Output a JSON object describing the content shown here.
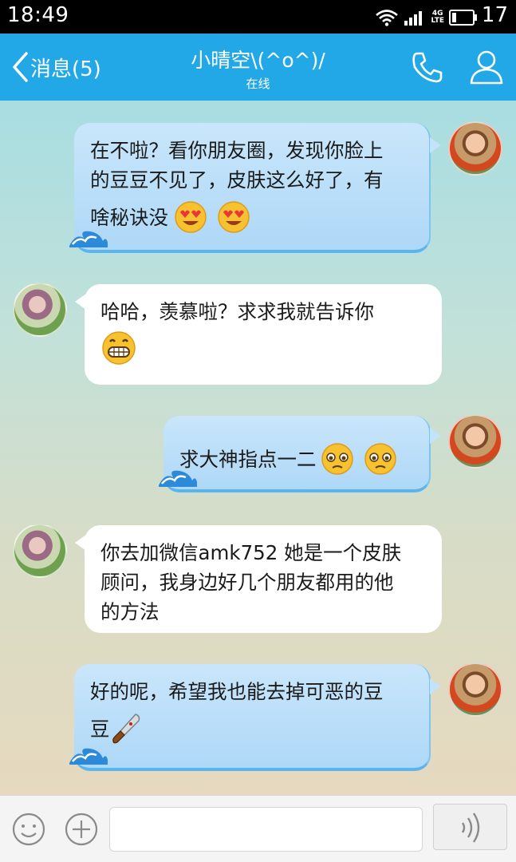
{
  "status_bar": {
    "time": "18:49",
    "network": "4G",
    "network_sub": "LTE",
    "battery_level": "17",
    "icons": [
      "wifi-icon",
      "signal-icon",
      "battery-icon"
    ]
  },
  "header": {
    "back_label": "消息(5)",
    "contact_name": "小晴空\\(^o^)/",
    "contact_status": "在线",
    "icons": [
      "chevron-left-icon",
      "phone-icon",
      "person-icon"
    ],
    "bg_color": "#22a8e6"
  },
  "messages": [
    {
      "sender": "me",
      "lines": [
        "在不啦？看你朋友圈，发现你脸上",
        "的豆豆不见了，皮肤这么好了，有",
        "啥秘诀没"
      ],
      "emojis": [
        "heart-eyes-emoji",
        "heart-eyes-emoji"
      ]
    },
    {
      "sender": "friend",
      "lines": [
        "哈哈，羡慕啦？求求我就告诉你"
      ],
      "emojis": [
        "grin-emoji"
      ]
    },
    {
      "sender": "me",
      "lines": [
        "求大神指点一二"
      ],
      "emojis": [
        "pleading-emoji",
        "pleading-emoji"
      ]
    },
    {
      "sender": "friend",
      "lines": [
        "你去加微信amk752 她是一个皮肤",
        "顾问，我身边好几个朋友都用的他",
        "的方法"
      ],
      "emojis": []
    },
    {
      "sender": "me",
      "lines": [
        "好的呢，希望我也能去掉可恶的豆",
        "豆"
      ],
      "emojis": [
        "knife-emoji"
      ]
    }
  ],
  "input_bar": {
    "input_value": "",
    "icons": [
      "smile-icon",
      "plus-icon",
      "voice-icon"
    ]
  },
  "colors": {
    "my_bubble": "#b9def8",
    "friend_bubble": "#ffffff",
    "accent": "#22a8e6"
  }
}
